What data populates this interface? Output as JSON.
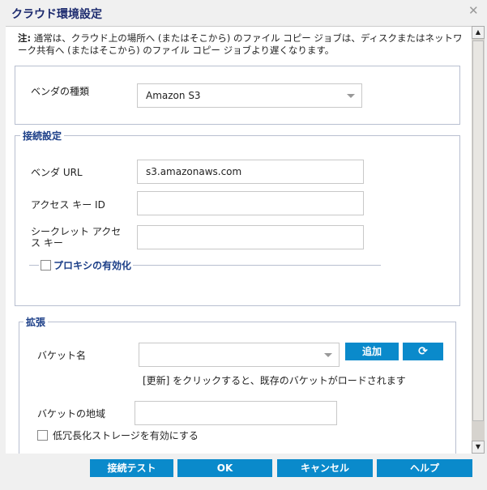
{
  "dialog": {
    "title": "クラウド環境設定"
  },
  "note": {
    "prefix": "注:",
    "text": " 通常は、クラウド上の場所へ (またはそこから) のファイル コピー ジョブは、ディスクまたはネットワーク共有へ (またはそこから) のファイル コピー ジョブより遅くなります。"
  },
  "vendor": {
    "label": "ベンダの種類",
    "value": "Amazon S3"
  },
  "connection": {
    "legend": "接続設定",
    "url_label": "ベンダ URL",
    "url_value": "s3.amazonaws.com",
    "access_key_label": "アクセス キー ID",
    "access_key_value": "",
    "secret_label": "シークレット アクセス キー",
    "secret_value": "",
    "proxy_label": "プロキシの有効化"
  },
  "advanced": {
    "legend": "拡張",
    "bucket_label": "バケット名",
    "bucket_value": "",
    "add_label": "追加",
    "refresh_hint": "[更新] をクリックすると、既存のバケットがロードされます",
    "region_label": "バケットの地域",
    "region_value": "",
    "rrs_label": "低冗長化ストレージを有効にする"
  },
  "footer": {
    "test": "接続テスト",
    "ok": "OK",
    "cancel": "キャンセル",
    "help": "ヘルプ"
  }
}
